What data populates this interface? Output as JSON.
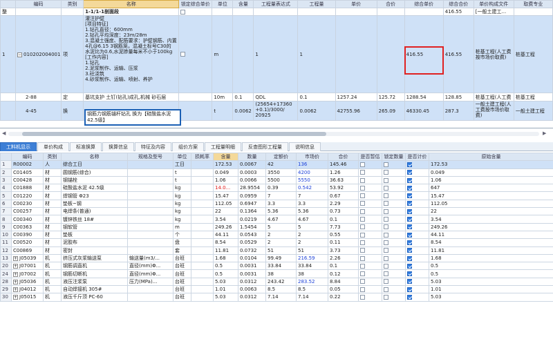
{
  "upper": {
    "columns": [
      "",
      "编码",
      "类别",
      "名称",
      "锁定综合单价",
      "单位",
      "含量",
      "工程量表达式",
      "工程量",
      "单价",
      "合价",
      "综合单价",
      "综合合价",
      "单价构成文件",
      "取费专业"
    ],
    "section": {
      "label": "整",
      "name": "1-1/1-1剖面段",
      "total": "416.55",
      "fee_file": "[一般土建工..."
    },
    "item1": {
      "num": "1",
      "code": "010202004001",
      "type": "项",
      "desc": "灌注护壁\n[项目特征]\n1.钻孔直径：600mm\n2.钻孔平均深度：23m/28m\n3.混凝土强度、配筋要求：护壁钢筋、内置\n4孔@6.15 3钢筋笼，混凝土标号C30的\n水泥比为0.6,水泥掺量每米不小于100kg\n[工作内容]\n1.钻孔\n2.泥浆制作、运输、压浆\n3.砼浇筑\n4.砂浆制作、运输、喷射、养护",
      "unit": "m",
      "expr": "1",
      "qty": "1",
      "comp": "416.55",
      "total": "416.55",
      "fee_file": "桩基工程(人工费\n按市场价取费)",
      "fee_major": "桩基工程"
    },
    "sub1": {
      "code": "2-88",
      "type": "定",
      "name": "基坑支护 土钉(钻孔)成孔,机械 砂石层",
      "unit": "10m",
      "content": "0.1",
      "expr": "QDL",
      "qty": "0.1",
      "price": "1257.24",
      "amount": "125.72",
      "comp": "1288.54",
      "total": "128.85",
      "fee_file": "桩基工程(人工费",
      "fee_major": "桩基工程"
    },
    "sub2": {
      "code": "4-45",
      "type": "换",
      "name": "钢筋力钢筋锚杆钻孔 换为【硅酸盐水泥\n42.5级】",
      "unit": "t",
      "content": "0.0062",
      "expr": "(25654+17360\n+0.1)/3000/\n20925",
      "qty": "0.0062",
      "price": "42755.96",
      "amount": "265.09",
      "comp": "46330.45",
      "total": "287.3",
      "fee_file": "一般土建工程(人\n工费按市场价取\n费)",
      "fee_major": "一般土建工程"
    }
  },
  "tabs": [
    "工料机显示",
    "单价构成",
    "标准换算",
    "换算信息",
    "特征及内容",
    "组价方案",
    "工程量明细",
    "反查图形工程量",
    "说明信息"
  ],
  "lower": {
    "columns": [
      "",
      "编码",
      "类别",
      "名称",
      "规格及型号",
      "单位",
      "损耗率",
      "含量",
      "数量",
      "定额价",
      "市场价",
      "合价",
      "是否暂估",
      "锁定数量",
      "是否计价",
      "原始含量"
    ],
    "rows": [
      {
        "n": "1",
        "code": "R00002",
        "type": "人",
        "name": "综合工日",
        "spec": "",
        "unit": "工日",
        "loss": "",
        "content": "172.53",
        "qty": "0.0067",
        "base": "42",
        "market": "136",
        "amount": "145.46",
        "market_style": "blue",
        "orig": "172.53"
      },
      {
        "n": "2",
        "code": "C01405",
        "type": "材",
        "name": "圆钢筋(综合)",
        "spec": "",
        "unit": "t",
        "loss": "",
        "content": "0.049",
        "qty": "0.0003",
        "base": "3550",
        "market": "4200",
        "amount": "1.26",
        "market_style": "blue",
        "orig": "0.049"
      },
      {
        "n": "3",
        "code": "C00428",
        "type": "材",
        "name": "钢锚栓",
        "spec": "",
        "unit": "t",
        "loss": "",
        "content": "1.06",
        "qty": "0.0066",
        "base": "5500",
        "market": "5550",
        "amount": "36.63",
        "market_style": "blue",
        "orig": "1.06"
      },
      {
        "n": "4",
        "code": "C01888",
        "type": "材",
        "name": "硅酸盐水泥 42.5级",
        "spec": "",
        "unit": "kg",
        "loss": "",
        "content": "14.0...",
        "qty": "28.9554",
        "base": "0.39",
        "market": "0.542",
        "amount": "53.92",
        "market_style": "blue",
        "content_style": "red",
        "orig": "647"
      },
      {
        "n": "5",
        "code": "C01220",
        "type": "材",
        "name": "焊钢管 Φ23",
        "spec": "",
        "unit": "kg",
        "loss": "",
        "content": "15.47",
        "qty": "0.0959",
        "base": "7",
        "market": "7",
        "amount": "0.67",
        "market_style": "",
        "orig": "15.47"
      },
      {
        "n": "6",
        "code": "C00230",
        "type": "材",
        "name": "垫板~钢",
        "spec": "",
        "unit": "kg",
        "loss": "",
        "content": "112.05",
        "qty": "0.6947",
        "base": "3.3",
        "market": "3.3",
        "amount": "2.29",
        "market_style": "",
        "orig": "112.05"
      },
      {
        "n": "7",
        "code": "C00257",
        "type": "材",
        "name": "电焊条(普通)",
        "spec": "",
        "unit": "kg",
        "loss": "",
        "content": "22",
        "qty": "0.1364",
        "base": "5.36",
        "market": "5.36",
        "amount": "0.73",
        "market_style": "",
        "orig": "22"
      },
      {
        "n": "8",
        "code": "C00340",
        "type": "材",
        "name": "镀锌铁丝 18#",
        "spec": "",
        "unit": "kg",
        "loss": "",
        "content": "3.54",
        "qty": "0.0219",
        "base": "4.67",
        "market": "4.67",
        "amount": "0.1",
        "market_style": "",
        "orig": "3.54"
      },
      {
        "n": "9",
        "code": "C00363",
        "type": "材",
        "name": "钢软管",
        "spec": "",
        "unit": "m",
        "loss": "",
        "content": "249.26",
        "qty": "1.5454",
        "base": "5",
        "market": "5",
        "amount": "7.73",
        "market_style": "",
        "orig": "249.26"
      },
      {
        "n": "10",
        "code": "C00390",
        "type": "材",
        "name": "垫板",
        "spec": "",
        "unit": "个",
        "loss": "",
        "content": "44.11",
        "qty": "0.0543",
        "base": "2",
        "market": "2",
        "amount": "0.55",
        "market_style": "",
        "orig": "44.11"
      },
      {
        "n": "11",
        "code": "C00520",
        "type": "材",
        "name": "泥胶布",
        "spec": "",
        "unit": "盘",
        "loss": "",
        "content": "8.54",
        "qty": "0.0529",
        "base": "2",
        "market": "2",
        "amount": "0.11",
        "market_style": "",
        "orig": "8.54"
      },
      {
        "n": "12",
        "code": "C00869",
        "type": "材",
        "name": "密封",
        "spec": "",
        "unit": "套",
        "loss": "",
        "content": "11.81",
        "qty": "0.0732",
        "base": "51",
        "market": "51",
        "amount": "3.73",
        "market_style": "",
        "orig": "11.81"
      },
      {
        "n": "13",
        "code": "J05039",
        "type": "机",
        "name": "挤压式灰浆输送泵",
        "spec": "输送量(m3/...",
        "unit": "台班",
        "loss": "",
        "content": "1.68",
        "qty": "0.0104",
        "base": "99.49",
        "market": "216.59",
        "amount": "2.26",
        "market_style": "blue",
        "orig": "1.68",
        "expand": "+"
      },
      {
        "n": "20",
        "code": "J07001",
        "type": "机",
        "name": "钢筋调直机",
        "spec": "直径(mm)Φ...",
        "unit": "台班",
        "loss": "",
        "content": "0.5",
        "qty": "0.0031",
        "base": "33.84",
        "market": "33.84",
        "amount": "0.1",
        "market_style": "",
        "orig": "0.5",
        "expand": "+"
      },
      {
        "n": "24",
        "code": "J07002",
        "type": "机",
        "name": "钢筋切断机",
        "spec": "直径(mm)Φ...",
        "unit": "台班",
        "loss": "",
        "content": "0.5",
        "qty": "0.0031",
        "base": "38",
        "market": "38",
        "amount": "0.12",
        "market_style": "",
        "orig": "0.5",
        "expand": "+"
      },
      {
        "n": "28",
        "code": "J05036",
        "type": "机",
        "name": "液压注浆泵",
        "spec": "压力(MPa)...",
        "unit": "台班",
        "loss": "",
        "content": "5.03",
        "qty": "0.0312",
        "base": "243.42",
        "market": "283.52",
        "amount": "8.84",
        "market_style": "blue",
        "orig": "5.03",
        "expand": "+"
      },
      {
        "n": "29",
        "code": "J04012",
        "type": "机",
        "name": "自动焊接机 305#",
        "spec": "",
        "unit": "台班",
        "loss": "",
        "content": "1.01",
        "qty": "0.0063",
        "base": "8.5",
        "market": "8.5",
        "amount": "0.05",
        "market_style": "",
        "orig": "1.01",
        "expand": "+"
      },
      {
        "n": "30",
        "code": "J05015",
        "type": "机",
        "name": "液压千斤顶 PC-60",
        "spec": "",
        "unit": "台班",
        "loss": "",
        "content": "5.03",
        "qty": "0.0312",
        "base": "7.14",
        "market": "7.14",
        "amount": "0.22",
        "market_style": "",
        "orig": "5.03",
        "expand": "+"
      }
    ]
  }
}
